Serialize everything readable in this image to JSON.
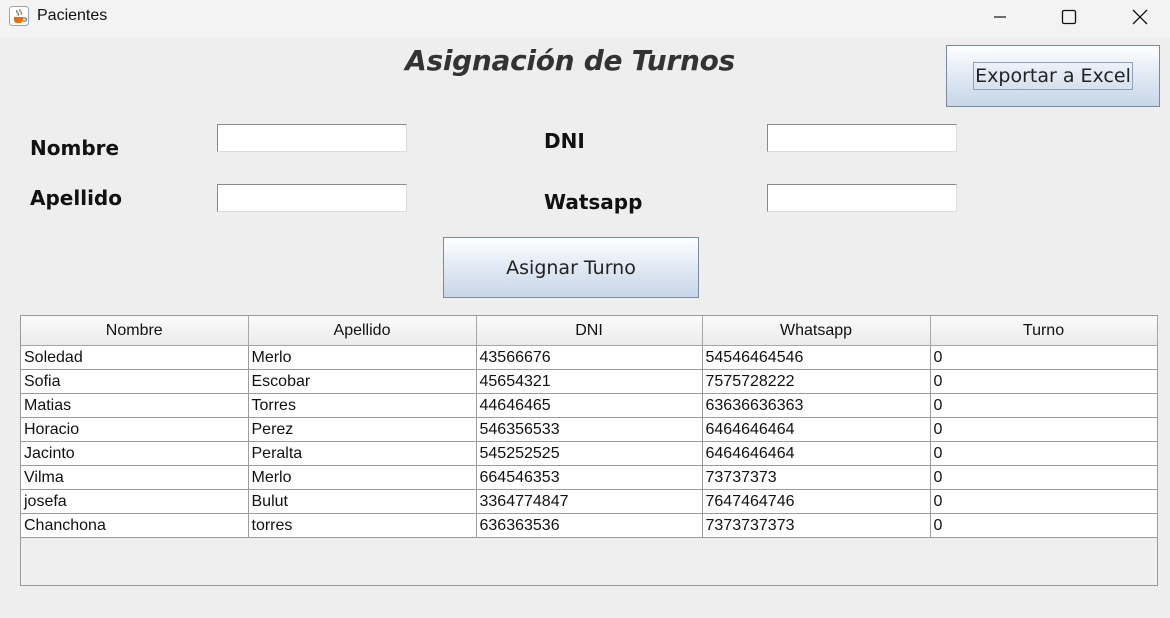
{
  "window": {
    "title": "Pacientes",
    "icon": "java-cup-icon"
  },
  "header": {
    "title": "Asignación de Turnos",
    "export_label": "Exportar a Excel"
  },
  "form": {
    "nombre_label": "Nombre",
    "apellido_label": "Apellido",
    "dni_label": "DNI",
    "whatsapp_label": "Watsapp",
    "nombre_value": "",
    "apellido_value": "",
    "dni_value": "",
    "whatsapp_value": "",
    "assign_label": "Asignar Turno"
  },
  "table": {
    "columns": [
      "Nombre",
      "Apellido",
      "DNI",
      "Whatsapp",
      "Turno"
    ],
    "rows": [
      [
        "Soledad",
        "Merlo",
        "43566676",
        "54546464546",
        "0"
      ],
      [
        "Sofia",
        "Escobar",
        "45654321",
        "7575728222",
        "0"
      ],
      [
        "Matias",
        "Torres",
        "44646465",
        "63636636363",
        "0"
      ],
      [
        "Horacio",
        "Perez",
        "546356533",
        "6464646464",
        "0"
      ],
      [
        "Jacinto",
        "Peralta",
        "545252525",
        "6464646464",
        "0"
      ],
      [
        "Vilma",
        "Merlo",
        "664546353",
        "73737373",
        "0"
      ],
      [
        "josefa",
        "Bulut",
        "3364774847",
        "7647464746",
        "0"
      ],
      [
        "Chanchona",
        "torres",
        "636363536",
        "7373737373",
        "0"
      ]
    ]
  }
}
